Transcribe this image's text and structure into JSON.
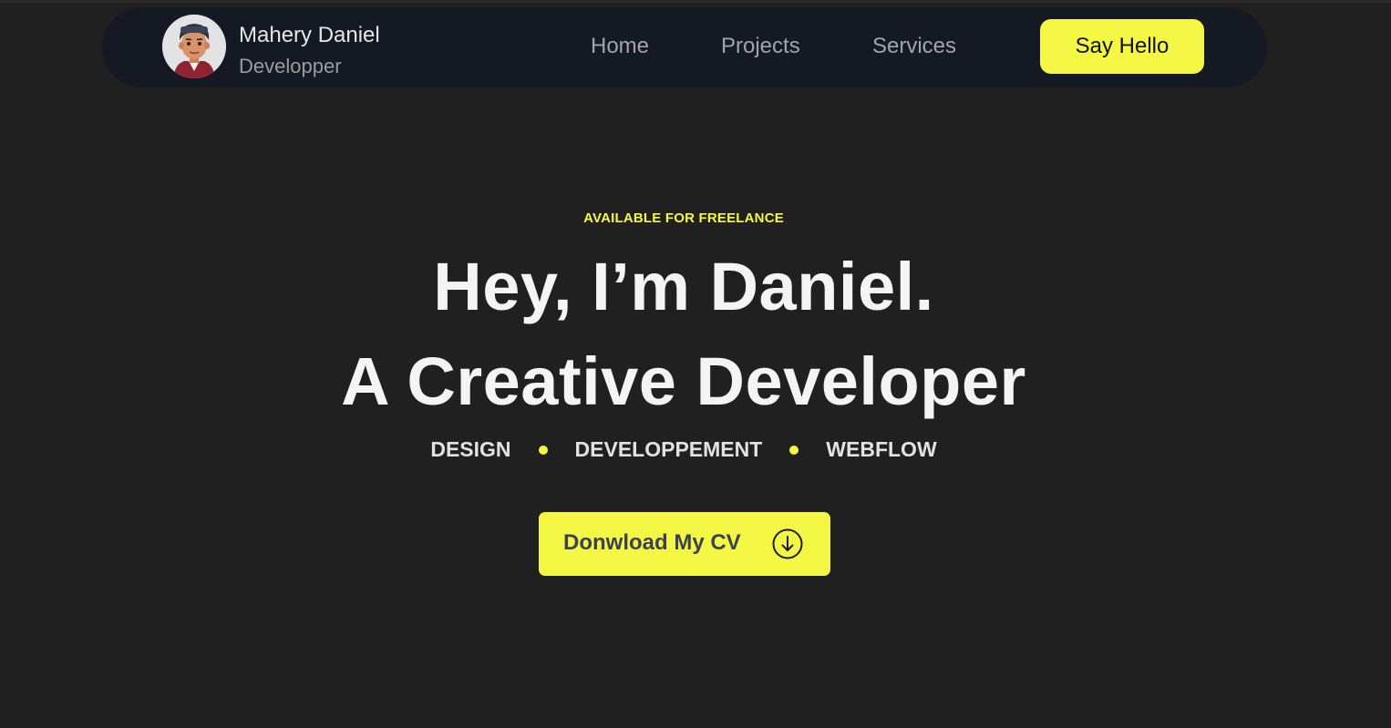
{
  "colors": {
    "background": "#202020",
    "navbar": "#151924",
    "accent": "#f4f744",
    "heading": "#f4f4f4",
    "nav_text": "#a4a4a8"
  },
  "brand": {
    "name": "Mahery Daniel",
    "role": "Developper",
    "avatar_icon": "cartoon-avatar"
  },
  "nav": {
    "links": [
      "Home",
      "Projects",
      "Services"
    ],
    "cta_label": "Say Hello"
  },
  "hero": {
    "eyebrow": "AVAILABLE FOR FREELANCE",
    "headline_line1": "Hey, I’m Daniel.",
    "headline_line2": "A Creative Developer",
    "skills": [
      "DESIGN",
      "DEVELOPPEMENT",
      "WEBFLOW"
    ],
    "cv_button_label": "Donwload My CV",
    "cv_button_icon": "arrow-down-circle-icon"
  }
}
